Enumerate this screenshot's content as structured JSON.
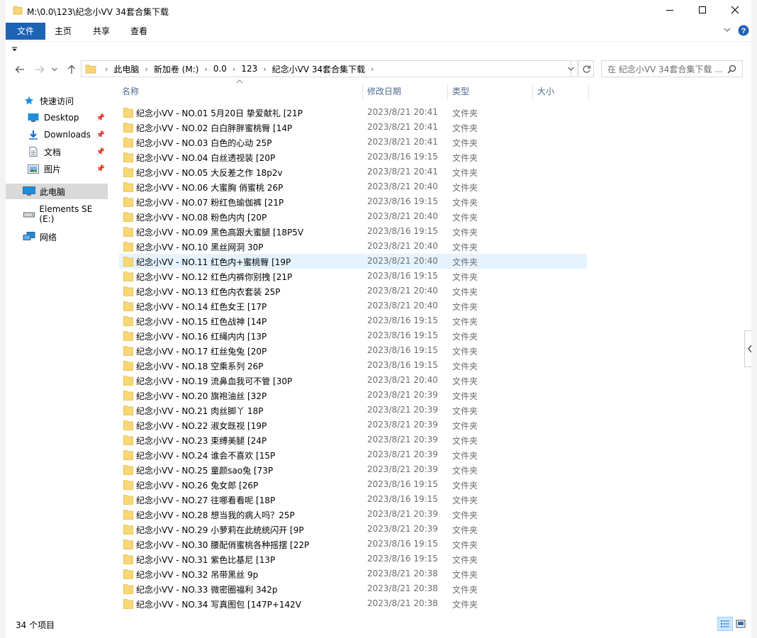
{
  "window": {
    "title": "M:\\0.0\\123\\纪念小VV 34套合集下载",
    "minimize_icon": "minimize-icon",
    "maximize_icon": "maximize-icon",
    "close_icon": "close-icon"
  },
  "ribbon": {
    "tabs": [
      {
        "label": "文件",
        "active": true
      },
      {
        "label": "主页",
        "active": false
      },
      {
        "label": "共享",
        "active": false
      },
      {
        "label": "查看",
        "active": false
      }
    ],
    "accent": "#1d63b5"
  },
  "address": {
    "crumbs": [
      "此电脑",
      "新加卷 (M:)",
      "0.0",
      "123",
      "纪念小VV 34套合集下载"
    ]
  },
  "search": {
    "placeholder": "在 纪念小VV 34套合集下载 ..."
  },
  "sidebar": {
    "items": [
      {
        "label": "快速访问",
        "icon": "star-icon",
        "pinned": false
      },
      {
        "label": "Desktop",
        "icon": "desktop-icon",
        "pinned": true
      },
      {
        "label": "Downloads",
        "icon": "download-icon",
        "pinned": true
      },
      {
        "label": "文档",
        "icon": "document-icon",
        "pinned": true
      },
      {
        "label": "图片",
        "icon": "pictures-icon",
        "pinned": true
      },
      {
        "label": "此电脑",
        "icon": "computer-icon",
        "pinned": false,
        "selected": true
      },
      {
        "label": "Elements SE (E:)",
        "icon": "drive-icon",
        "pinned": false
      },
      {
        "label": "网络",
        "icon": "network-icon",
        "pinned": false
      }
    ]
  },
  "columns": {
    "name": "名称",
    "date": "修改日期",
    "type": "类型",
    "size": "大小"
  },
  "files": [
    {
      "name": "纪念小VV - NO.01 5月20日 挚爱献礼 [21P",
      "date": "2023/8/21 20:41",
      "type": "文件夹"
    },
    {
      "name": "纪念小VV - NO.02 白白胖胖蜜桃臀 [14P",
      "date": "2023/8/21 20:41",
      "type": "文件夹"
    },
    {
      "name": "纪念小VV - NO.03 白色的心动 25P",
      "date": "2023/8/21 20:41",
      "type": "文件夹"
    },
    {
      "name": "纪念小VV - NO.04 白丝透视装 [20P",
      "date": "2023/8/16 19:15",
      "type": "文件夹"
    },
    {
      "name": "纪念小VV - NO.05 大反差之作 18p2v",
      "date": "2023/8/21 20:41",
      "type": "文件夹"
    },
    {
      "name": "纪念小VV - NO.06 大蜜胸 俏蜜桃 26P",
      "date": "2023/8/21 20:40",
      "type": "文件夹"
    },
    {
      "name": "纪念小VV - NO.07 粉红色瑜伽裤 [21P",
      "date": "2023/8/16 19:15",
      "type": "文件夹"
    },
    {
      "name": "纪念小VV - NO.08 粉色内内 [20P",
      "date": "2023/8/21 20:40",
      "type": "文件夹"
    },
    {
      "name": "纪念小VV - NO.09 黑色高跟大蜜腿 [18P5V",
      "date": "2023/8/16 19:15",
      "type": "文件夹"
    },
    {
      "name": "纪念小VV - NO.10 黑丝网洞 30P",
      "date": "2023/8/21 20:40",
      "type": "文件夹"
    },
    {
      "name": "纪念小VV - NO.11 红色内+蜜桃臀 [19P",
      "date": "2023/8/21 20:40",
      "type": "文件夹",
      "hover": true
    },
    {
      "name": "纪念小VV - NO.12 红色内裤你别拽 [21P",
      "date": "2023/8/16 19:15",
      "type": "文件夹"
    },
    {
      "name": "纪念小VV - NO.13 红色内衣套装 25P",
      "date": "2023/8/21 20:40",
      "type": "文件夹"
    },
    {
      "name": "纪念小VV - NO.14 红色女王 [17P",
      "date": "2023/8/21 20:40",
      "type": "文件夹"
    },
    {
      "name": "纪念小VV - NO.15 红色战神 [14P",
      "date": "2023/8/16 19:15",
      "type": "文件夹"
    },
    {
      "name": "纪念小VV - NO.16 红绳内内 [13P",
      "date": "2023/8/16 19:15",
      "type": "文件夹"
    },
    {
      "name": "纪念小VV - NO.17 红丝兔兔 [20P",
      "date": "2023/8/16 19:15",
      "type": "文件夹"
    },
    {
      "name": "纪念小VV - NO.18 空乘系列 26P",
      "date": "2023/8/16 19:15",
      "type": "文件夹"
    },
    {
      "name": "纪念小VV - NO.19 流鼻血我可不管 [30P",
      "date": "2023/8/21 20:40",
      "type": "文件夹"
    },
    {
      "name": "纪念小VV - NO.20 旗袍油丝 [32P",
      "date": "2023/8/21 20:39",
      "type": "文件夹"
    },
    {
      "name": "纪念小VV - NO.21 肉丝脚丫 18P",
      "date": "2023/8/21 20:39",
      "type": "文件夹"
    },
    {
      "name": "纪念小VV - NO.22 淑女既视 [19P",
      "date": "2023/8/21 20:39",
      "type": "文件夹"
    },
    {
      "name": "纪念小VV - NO.23 束缚美腿 [24P",
      "date": "2023/8/21 20:39",
      "type": "文件夹"
    },
    {
      "name": "纪念小VV - NO.24 谁会不喜欢 [15P",
      "date": "2023/8/21 20:39",
      "type": "文件夹"
    },
    {
      "name": "纪念小VV - NO.25 童颜sao兔 [73P",
      "date": "2023/8/21 20:39",
      "type": "文件夹"
    },
    {
      "name": "纪念小VV - NO.26 兔女郎 [26P",
      "date": "2023/8/16 19:15",
      "type": "文件夹"
    },
    {
      "name": "纪念小VV - NO.27 往哪看看呢 [18P",
      "date": "2023/8/16 19:15",
      "type": "文件夹"
    },
    {
      "name": "纪念小VV - NO.28 想当我的病人吗？25P",
      "date": "2023/8/21 20:39",
      "type": "文件夹"
    },
    {
      "name": "纪念小VV - NO.29 小萝莉在此统统闪开 [9P",
      "date": "2023/8/21 20:39",
      "type": "文件夹"
    },
    {
      "name": "纪念小VV - NO.30 腰配俏蜜桃各种摇摆 [22P",
      "date": "2023/8/16 19:15",
      "type": "文件夹"
    },
    {
      "name": "纪念小VV - NO.31 紫色比基尼 [13P",
      "date": "2023/8/16 19:15",
      "type": "文件夹"
    },
    {
      "name": "纪念小VV - NO.32 吊带黑丝 9p",
      "date": "2023/8/21 20:38",
      "type": "文件夹"
    },
    {
      "name": "纪念小VV - NO.33 微密圈福利 342p",
      "date": "2023/8/21 20:38",
      "type": "文件夹"
    },
    {
      "name": "纪念小VV - NO.34 写真图包 [147P+142V",
      "date": "2023/8/21 20:38",
      "type": "文件夹"
    }
  ],
  "status": {
    "count": "34 个项目"
  },
  "colors": {
    "folder": "#f8d775",
    "folder_dark": "#e8b94a",
    "header_text": "#4d6a8f",
    "hover_row": "#e5f3ff",
    "selected_nav": "#d9d9d9"
  }
}
